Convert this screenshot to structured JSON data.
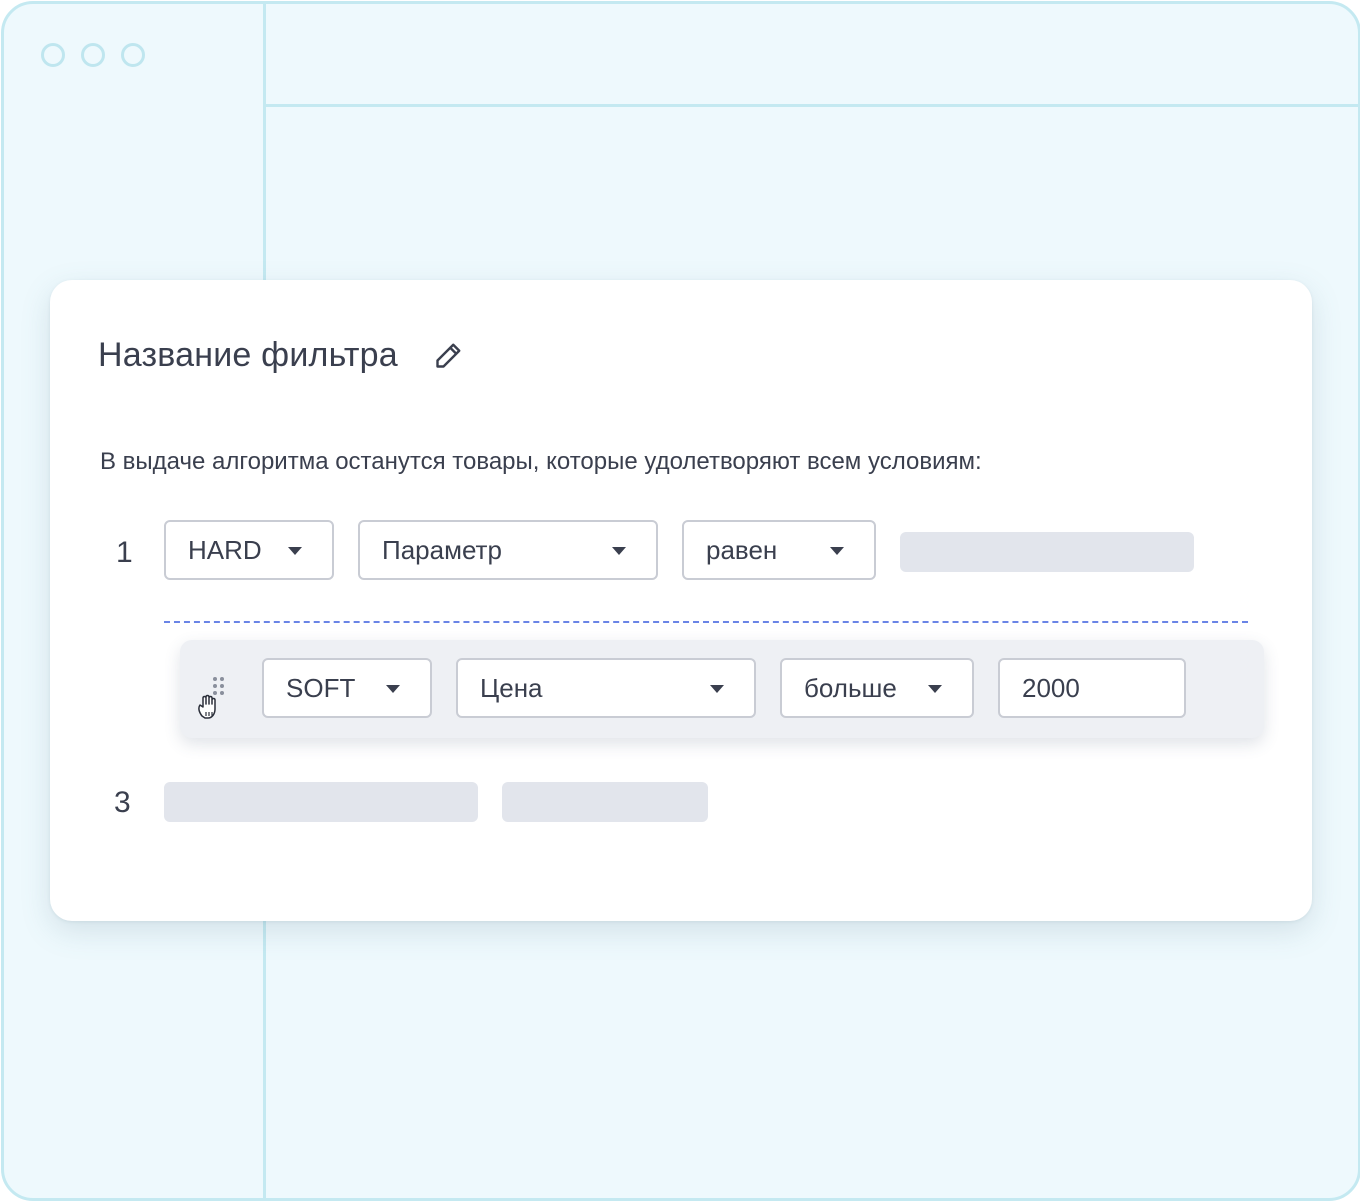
{
  "window": {
    "controls": [
      "window-dot",
      "window-dot",
      "window-dot"
    ]
  },
  "filter": {
    "title": "Название фильтра",
    "edit_icon": "pencil-icon",
    "description": "В выдаче алгоритма останутся товары, которые удолетворяют всем условиям:"
  },
  "conditions": [
    {
      "number": "1",
      "type": "HARD",
      "parameter": "Параметр",
      "operator": "равен",
      "value": ""
    },
    {
      "number": "",
      "type": "SOFT",
      "parameter": "Цена",
      "operator": "больше",
      "value": "2000",
      "state": "dragging"
    },
    {
      "number": "3",
      "type": "",
      "parameter": "",
      "operator": "",
      "value": "",
      "state": "loading"
    }
  ],
  "colors": {
    "window_bg": "#eef9fd",
    "window_border": "#c4e9f1",
    "card_bg": "#ffffff",
    "text": "#3a3f4e",
    "field_border": "#c9ccd4",
    "skeleton": "#e2e5ec",
    "drop_indicator": "#6a84e6",
    "drag_row_bg": "#eef0f4"
  },
  "icons": {
    "dropdown": "caret-down-icon",
    "drag": "drag-handle-icon",
    "cursor": "grab-hand-cursor-icon"
  }
}
